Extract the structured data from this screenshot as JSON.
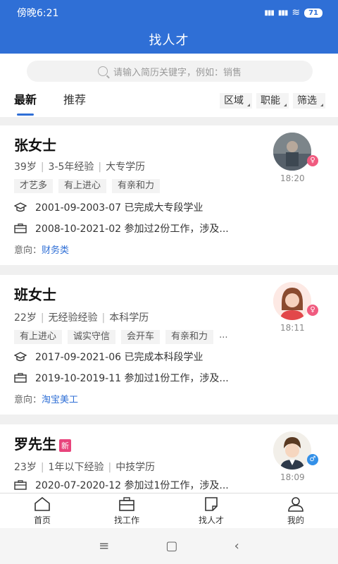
{
  "status": {
    "time": "傍晚6:21",
    "battery": "71",
    "signal1": "HD",
    "signal2": "HD"
  },
  "title": "找人才",
  "search": {
    "placeholder": "请输入简历关键字，例如：销售"
  },
  "tabs": [
    {
      "label": "最新",
      "active": true
    },
    {
      "label": "推荐",
      "active": false
    }
  ],
  "filters": [
    "区域",
    "职能",
    "筛选"
  ],
  "candidates": [
    {
      "name": "张女士",
      "new": "",
      "gender": "female",
      "age": "39岁",
      "experience": "3-5年经验",
      "education": "大专学历",
      "tags": [
        "才艺多",
        "有上进心",
        "有亲和力"
      ],
      "more": "",
      "edu_line": "2001-09-2003-07 已完成大专段学业",
      "work_line": "2008-10-2021-02 参加过2份工作，涉及...",
      "intent_label": "意向：",
      "intent_job": "财务类",
      "time": "18:20"
    },
    {
      "name": "班女士",
      "new": "",
      "gender": "female",
      "age": "22岁",
      "experience": "无经验经验",
      "education": "本科学历",
      "tags": [
        "有上进心",
        "诚实守信",
        "会开车",
        "有亲和力"
      ],
      "more": "...",
      "edu_line": "2017-09-2021-06 已完成本科段学业",
      "work_line": "2019-10-2019-11 参加过1份工作，涉及...",
      "intent_label": "意向：",
      "intent_job": "淘宝美工",
      "time": "18:11"
    },
    {
      "name": "罗先生",
      "new": "新",
      "gender": "male",
      "age": "23岁",
      "experience": "1年以下经验",
      "education": "中技学历",
      "work_line": "2020-07-2020-12 参加过1份工作，涉及...",
      "time": "18:09"
    }
  ],
  "nav": [
    {
      "label": "首页",
      "icon": "home-icon"
    },
    {
      "label": "找工作",
      "icon": "briefcase-icon"
    },
    {
      "label": "找人才",
      "icon": "document-icon"
    },
    {
      "label": "我的",
      "icon": "person-icon"
    }
  ],
  "colors": {
    "primary": "#2f6fd6",
    "female": "#f05b7f",
    "male": "#3390e8",
    "new_badge": "#e8447c"
  }
}
